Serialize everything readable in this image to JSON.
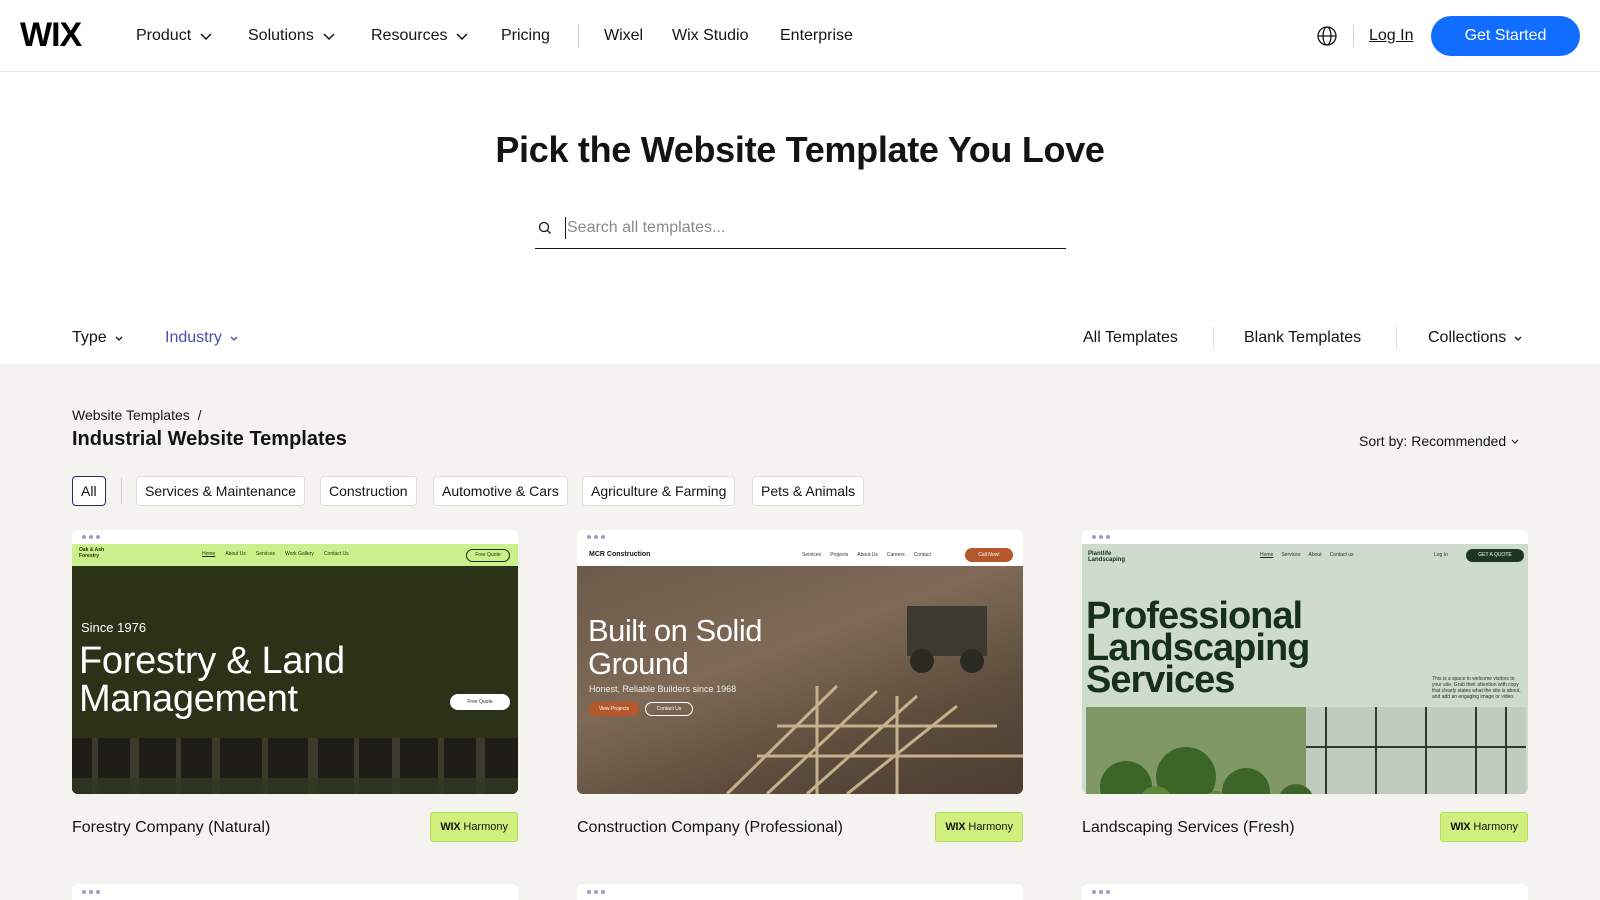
{
  "nav": {
    "logo": "WIX",
    "items": [
      "Product",
      "Solutions",
      "Resources",
      "Pricing"
    ],
    "secondary": [
      "Wixel",
      "Wix Studio",
      "Enterprise"
    ],
    "login": "Log In",
    "cta": "Get Started",
    "accent": "#116dff"
  },
  "hero": {
    "title": "Pick the Website Template You Love",
    "search_placeholder": "Search all templates..."
  },
  "filters": {
    "type": "Type",
    "industry": "Industry",
    "all_templates": "All Templates",
    "blank_templates": "Blank Templates",
    "collections": "Collections"
  },
  "content": {
    "breadcrumb": "Website Templates",
    "breadcrumb_sep": "/",
    "heading": "Industrial Website Templates",
    "sort_label": "Sort by:",
    "sort_value": "Recommended",
    "chips": [
      "All",
      "Services & Maintenance",
      "Construction",
      "Automotive & Cars",
      "Agriculture & Farming",
      "Pets & Animals"
    ]
  },
  "cards": [
    {
      "title": "Forestry Company (Natural)",
      "badge_brand": "WIX",
      "badge_text": "Harmony",
      "preview": {
        "brand": "Oak & Ash Forestry",
        "links": [
          "Home",
          "About Us",
          "Services",
          "Work Gallery",
          "Contact Us"
        ],
        "button": "Free Quote",
        "eyebrow": "Since 1976",
        "headline_1": "Forestry & Land",
        "headline_2": "Management",
        "cta": "Free Quote"
      }
    },
    {
      "title": "Construction Company (Professional)",
      "badge_brand": "WIX",
      "badge_text": "Harmony",
      "preview": {
        "brand": "MCR Construction",
        "links": [
          "Services",
          "Projects",
          "About Us",
          "Careers",
          "Contact"
        ],
        "button": "Call Now!",
        "headline_1": "Built on Solid",
        "headline_2": "Ground",
        "sub": "Honest, Reliable Builders since 1968",
        "cta_1": "View Projects",
        "cta_2": "Contact Us"
      }
    },
    {
      "title": "Landscaping Services (Fresh)",
      "badge_brand": "WIX",
      "badge_text": "Harmony",
      "preview": {
        "brand": "Plantlife Landscaping",
        "links": [
          "Home",
          "Services",
          "About",
          "Contact us"
        ],
        "login": "Log In",
        "button": "GET A QUOTE",
        "headline_1": "Professional",
        "headline_2": "Landscaping",
        "headline_3": "Services",
        "desc": "This is a space to welcome visitors to your site. Grab their attention with copy that clearly states what the site is about, and add an engaging image or video."
      }
    }
  ]
}
